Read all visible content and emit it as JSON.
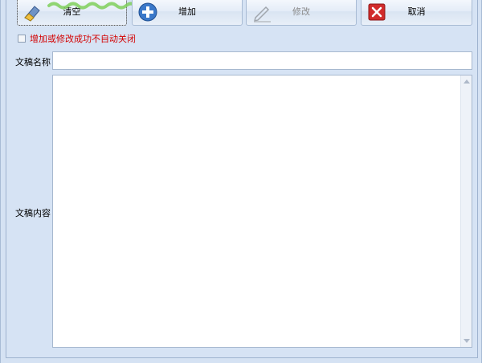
{
  "toolbar": {
    "clear_label": "清空",
    "add_label": "增加",
    "edit_label": "修改",
    "cancel_label": "取消"
  },
  "options": {
    "close_after_success_label": "增加或修改成功不自动关闭",
    "close_after_success_checked": false
  },
  "form": {
    "name_label": "文稿名称",
    "name_value": "",
    "content_label": "文稿内容",
    "content_value": ""
  },
  "colors": {
    "warning_text": "#d40000",
    "window_bg": "#d6e3f4",
    "cancel_icon_bg": "#d12b2b",
    "add_icon_bg": "#3a78c9"
  },
  "icons": {
    "clear": "eraser-icon",
    "add": "plus-circle-icon",
    "edit": "pencil-icon",
    "cancel": "close-icon"
  }
}
